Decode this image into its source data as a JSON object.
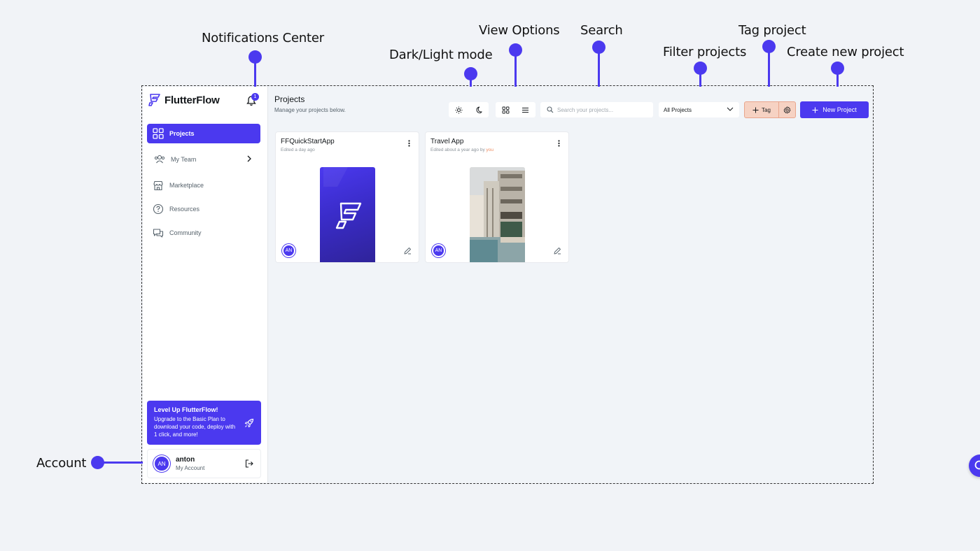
{
  "annotations": {
    "notifications": "Notifications Center",
    "theme": "Dark/Light mode",
    "view": "View Options",
    "search": "Search",
    "filter": "Filter projects",
    "tag": "Tag project",
    "create": "Create new project",
    "account": "Account"
  },
  "app": {
    "logo_text": "FlutterFlow",
    "notification_count": "1"
  },
  "sidebar": {
    "items": [
      {
        "label": "Projects",
        "icon": "grid-icon",
        "active": true
      },
      {
        "label": "My Team",
        "icon": "team-icon"
      },
      {
        "label": "Marketplace",
        "icon": "store-icon"
      },
      {
        "label": "Resources",
        "icon": "help-icon"
      },
      {
        "label": "Community",
        "icon": "chat-icon"
      }
    ],
    "promo": {
      "title": "Level Up FlutterFlow!",
      "body": "Upgrade to the Basic Plan to download your code, deploy with 1 click, and more!"
    },
    "account": {
      "initials": "AN",
      "name": "anton",
      "subtitle": "My Account"
    }
  },
  "main": {
    "title": "Projects",
    "subtitle": "Manage your projects below.",
    "search_placeholder": "Search your projects...",
    "filter_value": "All Projects",
    "tag_label": "Tag",
    "new_project_label": "New Project"
  },
  "projects": [
    {
      "name": "FFQuickStartApp",
      "edited": "Edited a day ago",
      "edited_by": "",
      "owner_initials": "AN"
    },
    {
      "name": "Travel App",
      "edited": "Edited about a year ago by",
      "edited_by": "you",
      "owner_initials": "AN"
    }
  ],
  "colors": {
    "primary": "#4b39ef",
    "tag_bg": "#f6d2c3",
    "accent_you": "#ee8b60"
  }
}
